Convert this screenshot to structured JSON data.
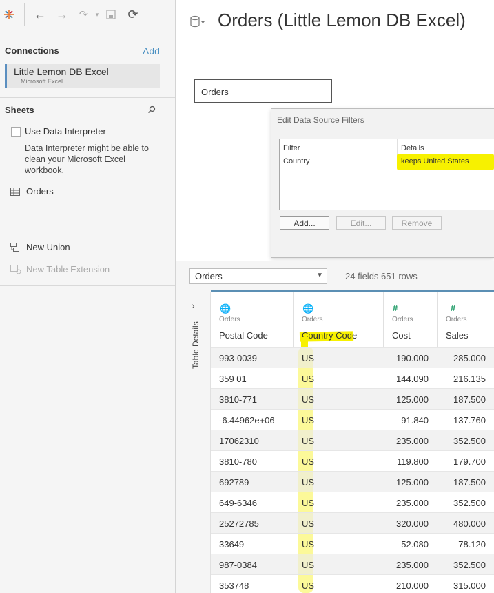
{
  "app": {
    "title": "Orders (Little Lemon DB Excel)"
  },
  "connections": {
    "heading": "Connections",
    "add_label": "Add",
    "items": [
      {
        "name": "Little Lemon DB Excel",
        "type": "Microsoft Excel"
      }
    ]
  },
  "sheets": {
    "heading": "Sheets",
    "use_interpreter_label": "Use Data Interpreter",
    "interpreter_note": "Data Interpreter might be able to clean your Microsoft Excel workbook.",
    "items": [
      {
        "label": "Orders"
      }
    ],
    "new_union": "New Union",
    "new_table_extension": "New Table Extension"
  },
  "canvas": {
    "table_box": "Orders"
  },
  "dialog": {
    "title": "Edit Data Source Filters",
    "columns": [
      "Filter",
      "Details"
    ],
    "rows": [
      {
        "filter": "Country",
        "details": "keeps United States"
      }
    ],
    "buttons": {
      "add": "Add...",
      "edit": "Edit...",
      "remove": "Remove"
    }
  },
  "datasource": {
    "selected": "Orders",
    "fields_info": "24 fields 651 rows",
    "details_label": "Table Details"
  },
  "grid": {
    "columns": [
      {
        "source": "Orders",
        "name": "Postal Code",
        "icon": "globe-icon"
      },
      {
        "source": "Orders",
        "name": "Country Code",
        "icon": "globe-icon"
      },
      {
        "source": "Orders",
        "name": "Cost",
        "icon": "hash-icon"
      },
      {
        "source": "Orders",
        "name": "Sales",
        "icon": "hash-icon"
      }
    ],
    "rows": [
      [
        "993-0039",
        "US",
        "190.000",
        "285.000"
      ],
      [
        "359 01",
        "US",
        "144.090",
        "216.135"
      ],
      [
        "3810-771",
        "US",
        "125.000",
        "187.500"
      ],
      [
        "-6.44962e+06",
        "US",
        "91.840",
        "137.760"
      ],
      [
        "17062310",
        "US",
        "235.000",
        "352.500"
      ],
      [
        "3810-780",
        "US",
        "119.800",
        "179.700"
      ],
      [
        "692789",
        "US",
        "125.000",
        "187.500"
      ],
      [
        "649-6346",
        "US",
        "235.000",
        "352.500"
      ],
      [
        "25272785",
        "US",
        "320.000",
        "480.000"
      ],
      [
        "33649",
        "US",
        "52.080",
        "78.120"
      ],
      [
        "987-0384",
        "US",
        "235.000",
        "352.500"
      ],
      [
        "353748",
        "US",
        "210.000",
        "315.000"
      ]
    ]
  },
  "colors": {
    "highlight": "#f7f100",
    "accent": "#5b8fb4",
    "link": "#4a90c2"
  }
}
